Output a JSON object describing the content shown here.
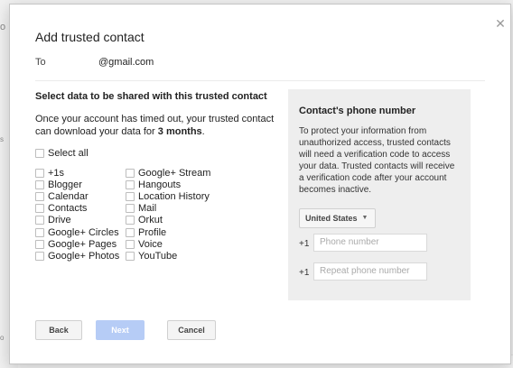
{
  "background": {
    "left_letters": [
      "o",
      "s",
      "o"
    ]
  },
  "dialog": {
    "title": "Add trusted contact",
    "close_icon": "close-icon",
    "to_label": "To",
    "to_email": "@gmail.com"
  },
  "data_section": {
    "title": "Select data to be shared with this trusted contact",
    "description_prefix": "Once your account has timed out, your trusted contact can download your data for ",
    "description_bold": "3 months",
    "description_suffix": ".",
    "select_all": "Select all",
    "left_items": [
      "+1s",
      "Blogger",
      "Calendar",
      "Contacts",
      "Drive",
      "Google+ Circles",
      "Google+ Pages",
      "Google+ Photos"
    ],
    "right_items": [
      "Google+ Stream",
      "Hangouts",
      "Location History",
      "Mail",
      "Orkut",
      "Profile",
      "Voice",
      "YouTube"
    ]
  },
  "phone_panel": {
    "title": "Contact's phone number",
    "description": "To protect your information from unauthorized access, trusted contacts will need a verification code to access your data. Trusted contacts will receive a verification code after your account becomes inactive.",
    "country": "United States",
    "country_code": "+1",
    "phone_placeholder": "Phone number",
    "repeat_placeholder": "Repeat phone number"
  },
  "buttons": {
    "back": "Back",
    "next": "Next",
    "cancel": "Cancel"
  },
  "colors": {
    "next_disabled": "#b6ccf6",
    "panel_bg": "#eeeeee"
  }
}
